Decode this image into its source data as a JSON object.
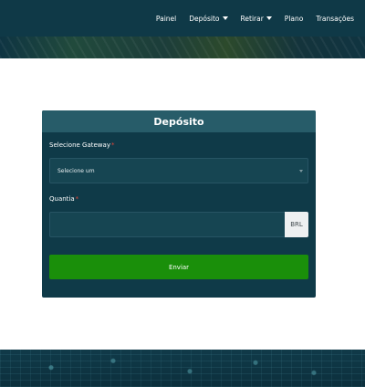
{
  "nav": {
    "items": [
      {
        "label": "Painel",
        "has_dropdown": false
      },
      {
        "label": "Depósito",
        "has_dropdown": true
      },
      {
        "label": "Retirar",
        "has_dropdown": true
      },
      {
        "label": "Plano",
        "has_dropdown": false
      },
      {
        "label": "Transações",
        "has_dropdown": false
      }
    ]
  },
  "form": {
    "title": "Depósito",
    "gateway_label": "Selecione Gateway",
    "gateway_required_mark": "*",
    "gateway_selected": "Selecione um",
    "amount_label": "Quantia",
    "amount_required_mark": "*",
    "amount_value": "",
    "currency": "BRL",
    "submit_label": "Enviar"
  },
  "colors": {
    "nav_bg": "#0f3947",
    "card_bg": "#0f3a48",
    "card_header": "#275c69",
    "submit": "#1a8f0a",
    "required": "#e0453a"
  }
}
